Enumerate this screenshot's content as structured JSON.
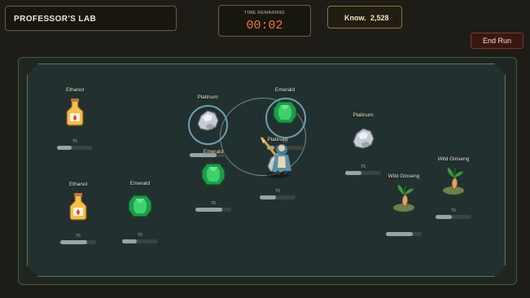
{
  "hud": {
    "title": "PROFESSOR'S LAB",
    "timer_label": "TIME REMAINING",
    "timer_value": "00:02",
    "knowledge_label": "Know.",
    "knowledge_value": "2,528",
    "end_run_label": "End Run"
  },
  "items": [
    {
      "name": "Ethanol",
      "tier": "T6",
      "type": "ethanol",
      "progress": 0.4
    },
    {
      "name": "Ethanol",
      "tier": "T6",
      "type": "ethanol",
      "progress": 0.75
    },
    {
      "name": "Emerald",
      "tier": "T6",
      "type": "emerald",
      "progress": 0.4
    },
    {
      "name": "Platinum",
      "tier": "",
      "type": "platinum",
      "progress": 0.75
    },
    {
      "name": "Emerald",
      "tier": "T6",
      "type": "emerald",
      "progress": 0.75
    },
    {
      "name": "Emerald",
      "tier": "T6",
      "type": "emerald",
      "progress": 0.2
    },
    {
      "name": "Platinum",
      "tier": "T6",
      "type": "platinum",
      "progress": 0.45
    },
    {
      "name": "Platinum",
      "tier": "T6",
      "type": "platinum",
      "progress": 0.45
    },
    {
      "name": "Wild Ginseng",
      "tier": "",
      "type": "ginseng",
      "progress": 0.75
    },
    {
      "name": "Wild Ginseng",
      "tier": "T6",
      "type": "ginseng",
      "progress": 0.45
    }
  ],
  "icons": {
    "ethanol": "ethanol-bottle-icon",
    "emerald": "emerald-gem-icon",
    "platinum": "platinum-ore-icon",
    "ginseng": "wild-ginseng-icon",
    "character": "professor-character-icon"
  }
}
